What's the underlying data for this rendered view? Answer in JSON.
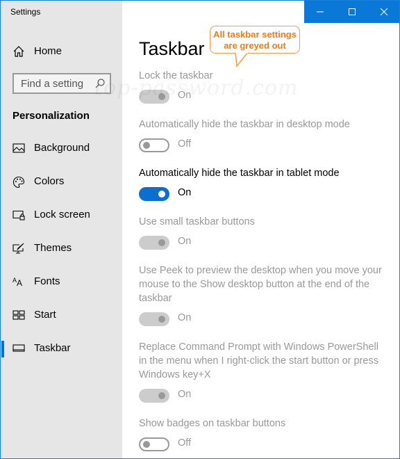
{
  "window": {
    "title": "Settings",
    "controls": {
      "minimize": "minimize",
      "maximize": "maximize",
      "close": "close"
    },
    "accent_color": "#0a78d7"
  },
  "sidebar": {
    "home_label": "Home",
    "search_placeholder": "Find a setting",
    "section_heading": "Personalization",
    "items": [
      {
        "label": "Background",
        "icon": "picture-icon",
        "active": false
      },
      {
        "label": "Colors",
        "icon": "palette-icon",
        "active": false
      },
      {
        "label": "Lock screen",
        "icon": "lock-screen-icon",
        "active": false
      },
      {
        "label": "Themes",
        "icon": "themes-icon",
        "active": false
      },
      {
        "label": "Fonts",
        "icon": "fonts-icon",
        "active": false
      },
      {
        "label": "Start",
        "icon": "start-icon",
        "active": false
      },
      {
        "label": "Taskbar",
        "icon": "taskbar-icon",
        "active": true
      }
    ]
  },
  "main": {
    "title": "Taskbar",
    "watermark": "top-password.com",
    "callout": {
      "line1": "All taskbar settings",
      "line2": "are greyed out"
    },
    "settings": [
      {
        "label": "Lock the taskbar",
        "state": "On",
        "enabled": false
      },
      {
        "label": "Automatically hide the taskbar in desktop mode",
        "state": "Off",
        "enabled": false
      },
      {
        "label": "Automatically hide the taskbar in tablet mode",
        "state": "On",
        "enabled": true
      },
      {
        "label": "Use small taskbar buttons",
        "state": "On",
        "enabled": false
      },
      {
        "label": "Use Peek to preview the desktop when you move your mouse to the Show desktop button at the end of the taskbar",
        "state": "On",
        "enabled": false
      },
      {
        "label": "Replace Command Prompt with Windows PowerShell in the menu when I right-click the start button or press Windows key+X",
        "state": "On",
        "enabled": false
      },
      {
        "label": "Show badges on taskbar buttons",
        "state": "Off",
        "enabled": false
      }
    ]
  }
}
